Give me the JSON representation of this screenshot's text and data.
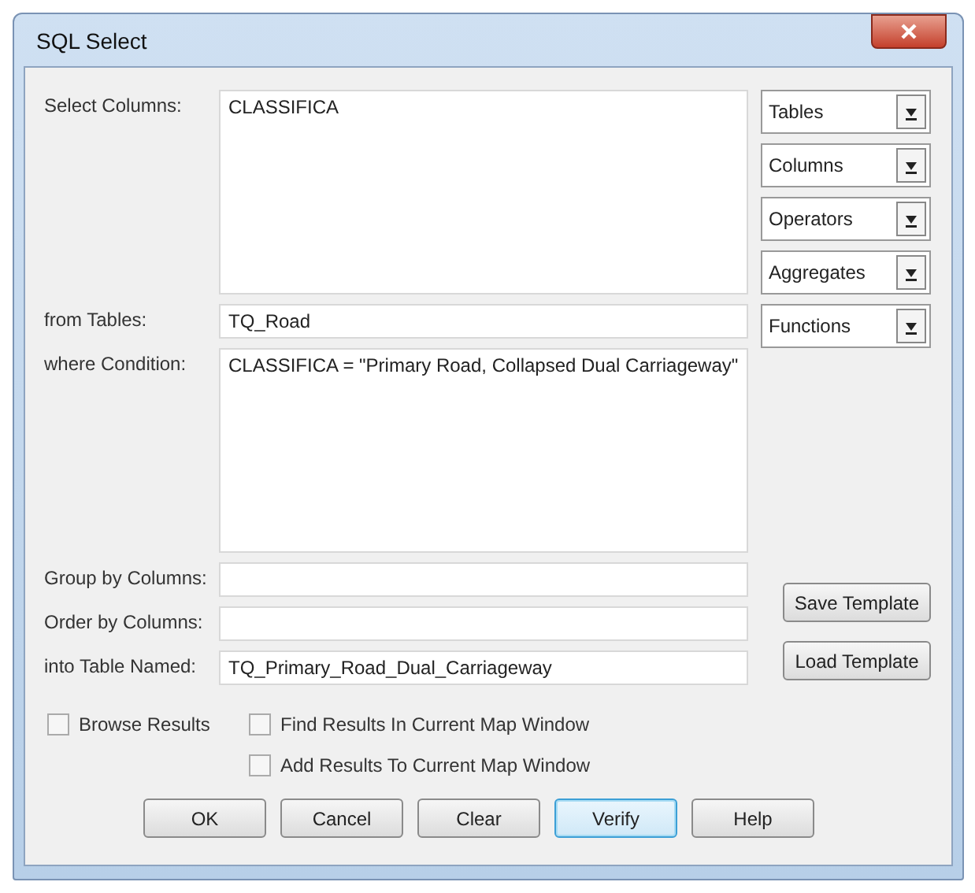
{
  "window": {
    "title": "SQL Select"
  },
  "fields": [
    {
      "label": "Select Columns:",
      "value": "CLASSIFICA",
      "kind": "multiline"
    },
    {
      "label": "from Tables:",
      "value": "TQ_Road",
      "kind": "single"
    },
    {
      "label": "where Condition:",
      "value": "CLASSIFICA = \"Primary Road, Collapsed Dual Carriageway\"",
      "kind": "multiline"
    },
    {
      "label": "Group by Columns:",
      "kind": "single"
    },
    {
      "label": "Order by Columns:",
      "kind": "single"
    },
    {
      "label": "into Table Named:",
      "value": "TQ_Primary_Road_Dual_Carriageway",
      "kind": "single"
    }
  ],
  "dropdowns": [
    "Tables",
    "Columns",
    "Operators",
    "Aggregates",
    "Functions"
  ],
  "template_buttons": [
    "Save Template",
    "Load Template"
  ],
  "checkboxes": [
    {
      "label": "Browse Results",
      "checked": false
    },
    {
      "label": "Find Results In Current Map Window",
      "checked": false
    },
    {
      "label": "Add Results To Current Map Window",
      "checked": false
    }
  ],
  "buttons": [
    {
      "label": "OK",
      "focused": false
    },
    {
      "label": "Cancel",
      "focused": false
    },
    {
      "label": "Clear",
      "focused": false
    },
    {
      "label": "Verify",
      "focused": true
    },
    {
      "label": "Help",
      "focused": false
    }
  ]
}
